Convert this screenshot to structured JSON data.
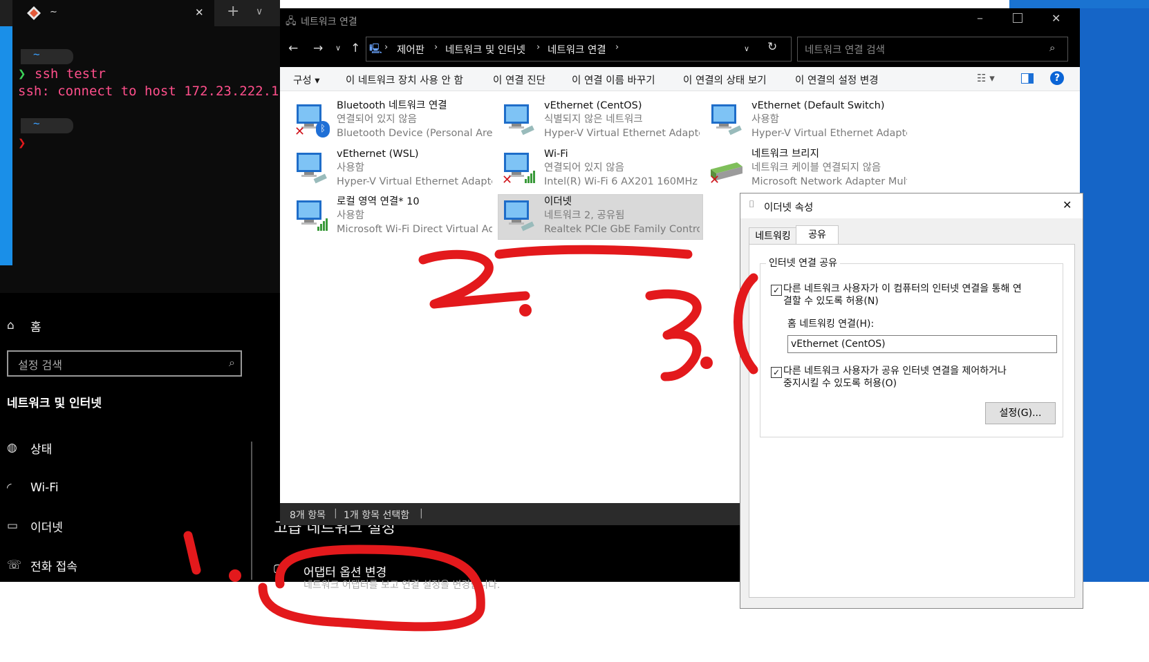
{
  "terminal": {
    "tab_title": "~",
    "prompt_path": "~",
    "prompt_symbol": "❯",
    "command": "ssh testr",
    "error": "ssh: connect to host 172.23.222.1",
    "prompt_path2": "~",
    "prompt_symbol2": "❯",
    "new_tab": "+",
    "dropdown": "∨",
    "close": "✕"
  },
  "settings": {
    "home": "홈",
    "search_placeholder": "설정 검색",
    "section_title": "네트워크 및 인터넷",
    "nav": [
      "상태",
      "Wi-Fi",
      "이더넷",
      "전화 접속"
    ],
    "advanced_heading": "고급 네트워크 설정",
    "adapter_title": "어댑터 옵션 변경",
    "adapter_sub": "네트워크 어댑터를 보고 연결 설정을 변경합니다."
  },
  "explorer": {
    "title": "네트워크 연결",
    "breadcrumb": [
      "제어판",
      "네트워크 및 인터넷",
      "네트워크 연결"
    ],
    "search_placeholder": "네트워크 연결 검색",
    "commands": [
      "구성 ▾",
      "이 네트워크 장치 사용 안 함",
      "이 연결 진단",
      "이 연결 이름 바꾸기",
      "이 연결의 상태 보기",
      "이 연결의 설정 변경"
    ],
    "items": [
      {
        "name": "Bluetooth 네트워크 연결",
        "status": "연결되어 있지 않음",
        "device": "Bluetooth Device (Personal Area ..."
      },
      {
        "name": "vEthernet (CentOS)",
        "status": "식별되지 않은 네트워크",
        "device": "Hyper-V Virtual Ethernet Adapte..."
      },
      {
        "name": "vEthernet (Default Switch)",
        "status": "사용함",
        "device": "Hyper-V Virtual Ethernet Adapter"
      },
      {
        "name": "vEthernet (WSL)",
        "status": "사용함",
        "device": "Hyper-V Virtual Ethernet Adapte..."
      },
      {
        "name": "Wi-Fi",
        "status": "연결되어 있지 않음",
        "device": "Intel(R) Wi-Fi 6 AX201 160MHz"
      },
      {
        "name": "네트워크 브리지",
        "status": "네트워크 케이블 연결되지 않음",
        "device": "Microsoft Network Adapter Multi..."
      },
      {
        "name": "로컬 영역 연결* 10",
        "status": "사용함",
        "device": "Microsoft Wi-Fi Direct Virtual Ad..."
      },
      {
        "name": "이더넷",
        "status": "네트워크 2, 공유됨",
        "device": "Realtek PCIe GbE Family Control..."
      }
    ],
    "status_count": "8개 항목",
    "status_selected": "1개 항목 선택함"
  },
  "dialog": {
    "title": "이더넷 속성",
    "tabs": [
      "네트워킹",
      "공유"
    ],
    "group_title": "인터넷 연결 공유",
    "check1_line1": "다른 네트워크 사용자가 이 컴퓨터의 인터넷 연결을 통해 연",
    "check1_line2": "결할 수 있도록 허용(N)",
    "home_conn_label": "홈 네트워킹 연결(H):",
    "home_conn_value": "vEthernet (CentOS)",
    "check2_line1": "다른 네트워크 사용자가 공유 인터넷 연결을 제어하거나",
    "check2_line2": "중지시킬 수 있도록 허용(O)",
    "settings_button": "설정(G)..."
  },
  "colors": {
    "annotation_red": "#e3191c",
    "selection": "#d9d9d9",
    "terminal_pink": "#ff4f8b",
    "help_blue": "#0a64d6"
  }
}
